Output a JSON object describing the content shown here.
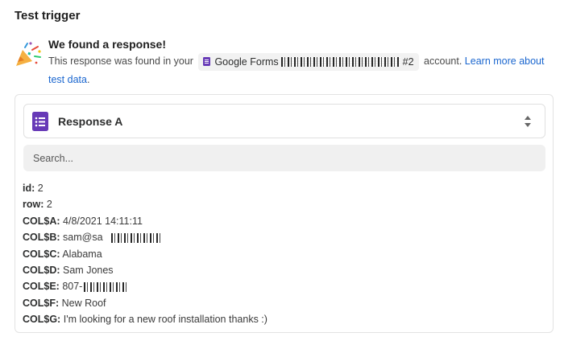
{
  "header": {
    "title": "Test trigger"
  },
  "result": {
    "heading": "We found a response!",
    "desc_prefix": "This response was found in your",
    "app_name": "Google Forms",
    "account_suffix": "#2",
    "desc_suffix": "account.",
    "learn_more": "Learn more about",
    "learn_more_2": "test data",
    "period": "."
  },
  "record_select": {
    "label": "Response A"
  },
  "search": {
    "placeholder": "Search..."
  },
  "fields": [
    {
      "key": "id:",
      "value": "2"
    },
    {
      "key": "row:",
      "value": "2"
    },
    {
      "key": "COL$A:",
      "value": "4/8/2021 14:11:11"
    },
    {
      "key": "COL$B:",
      "value": "sam@sa"
    },
    {
      "key": "COL$C:",
      "value": "Alabama"
    },
    {
      "key": "COL$D:",
      "value": "Sam Jones"
    },
    {
      "key": "COL$E:",
      "value": "807-"
    },
    {
      "key": "COL$F:",
      "value": "New Roof"
    },
    {
      "key": "COL$G:",
      "value": "I'm looking for a new roof installation thanks :)"
    }
  ],
  "icons": {
    "party": "party-popper-icon",
    "forms": "google-forms-icon",
    "chevrons": "chevron-up-down-icon"
  },
  "colors": {
    "forms_purple": "#673ab7",
    "link": "#1a66cf"
  }
}
